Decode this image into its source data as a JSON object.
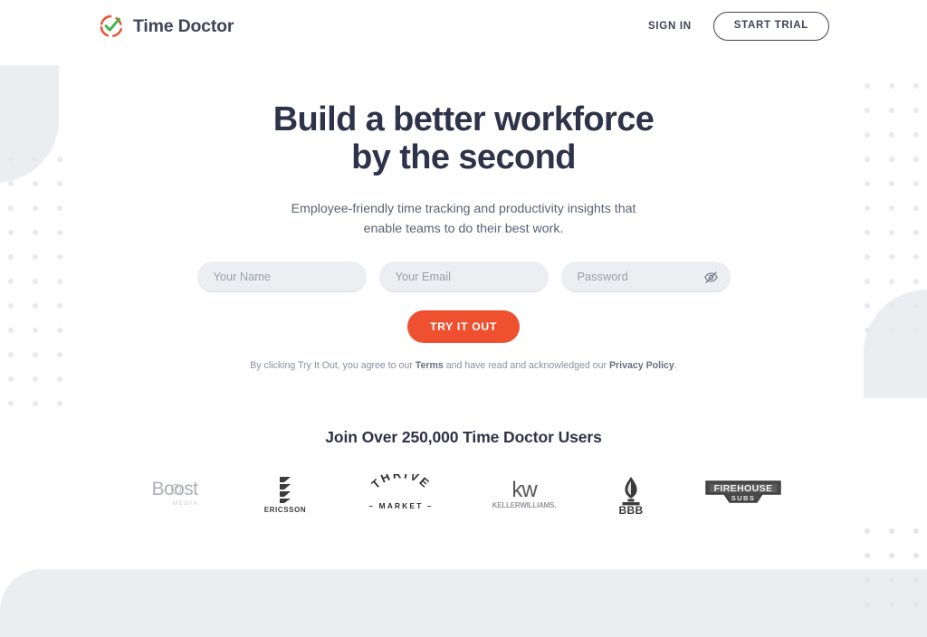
{
  "header": {
    "brand": {
      "name": "Time Doctor",
      "logo_icon": "timedoctor-clock-check-logo",
      "ring_color": "#ef5130",
      "check_color": "#3bb54a"
    },
    "sign_in_label": "SIGN IN",
    "start_trial_label": "START TRIAL"
  },
  "hero": {
    "headline_line1": "Build a better workforce",
    "headline_line2": "by the second",
    "subhead": "Employee-friendly time tracking and productivity insights that enable teams to do their best work.",
    "form": {
      "name_placeholder": "Your Name",
      "name_value": "",
      "email_placeholder": "Your Email",
      "email_value": "",
      "password_placeholder": "Password",
      "password_value": "",
      "password_toggle_icon": "eye-off-icon",
      "submit_label": "TRY IT OUT",
      "submit_color": "#ef5130"
    },
    "legal": {
      "prefix": "By clicking Try It Out, you agree to our ",
      "terms_label": "Terms",
      "middle": " and have read and acknowledged our ",
      "privacy_label": "Privacy Policy",
      "suffix": "."
    }
  },
  "social_proof": {
    "title": "Join Over 250,000 Time Doctor Users",
    "logos": [
      {
        "name": "Boost Media",
        "icon": "boost-media-logo",
        "primary": "Boost",
        "secondary": "MEDIA"
      },
      {
        "name": "Ericsson",
        "icon": "ericsson-logo",
        "primary": "ERICSSON",
        "secondary": ""
      },
      {
        "name": "Thrive Market",
        "icon": "thrive-market-logo",
        "primary": "THRIVE",
        "secondary": "MARKET"
      },
      {
        "name": "Keller Williams",
        "icon": "keller-williams-logo",
        "primary": "kw",
        "secondary": "KELLERWILLIAMS."
      },
      {
        "name": "BBB",
        "icon": "bbb-logo",
        "primary": "BBB",
        "secondary": ""
      },
      {
        "name": "Firehouse Subs",
        "icon": "firehouse-subs-logo",
        "primary": "FIREHOUSE",
        "secondary": "SUBS"
      }
    ]
  },
  "decor": {
    "shape_color": "#ebedf1",
    "dot_color": "#e7e9ee",
    "band_color": "#ebeef1"
  }
}
